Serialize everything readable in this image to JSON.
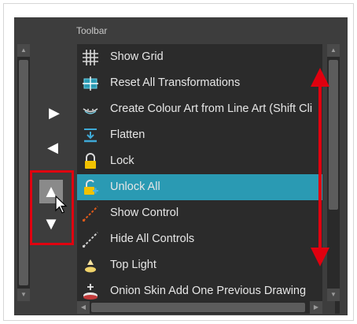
{
  "panel": {
    "title": "Toolbar"
  },
  "buttons": {
    "add": "▶",
    "remove": "◀",
    "move_up": "▲",
    "move_down": "▼"
  },
  "scroll": {
    "up": "▲",
    "down": "▼",
    "left": "◀",
    "right": "▶"
  },
  "toolbar_items": [
    {
      "label": "Show Grid",
      "icon": "grid-icon"
    },
    {
      "label": "Reset All Transformations",
      "icon": "reset-transform-icon"
    },
    {
      "label": "Create Colour Art from Line Art (Shift Cli",
      "icon": "colour-art-icon"
    },
    {
      "label": "Flatten",
      "icon": "flatten-icon"
    },
    {
      "label": "Lock",
      "icon": "lock-icon"
    },
    {
      "label": "Unlock All",
      "icon": "unlock-all-icon",
      "selected": true
    },
    {
      "label": "Show Control",
      "icon": "show-control-icon"
    },
    {
      "label": "Hide All Controls",
      "icon": "hide-controls-icon"
    },
    {
      "label": "Top Light",
      "icon": "top-light-icon"
    },
    {
      "label": "Onion Skin Add One Previous Drawing",
      "icon": "onion-skin-icon"
    }
  ],
  "colors": {
    "selection": "#2a9ab3",
    "highlight": "#e0000f",
    "panel": "#3d3d3d",
    "list": "#2b2b2b"
  }
}
